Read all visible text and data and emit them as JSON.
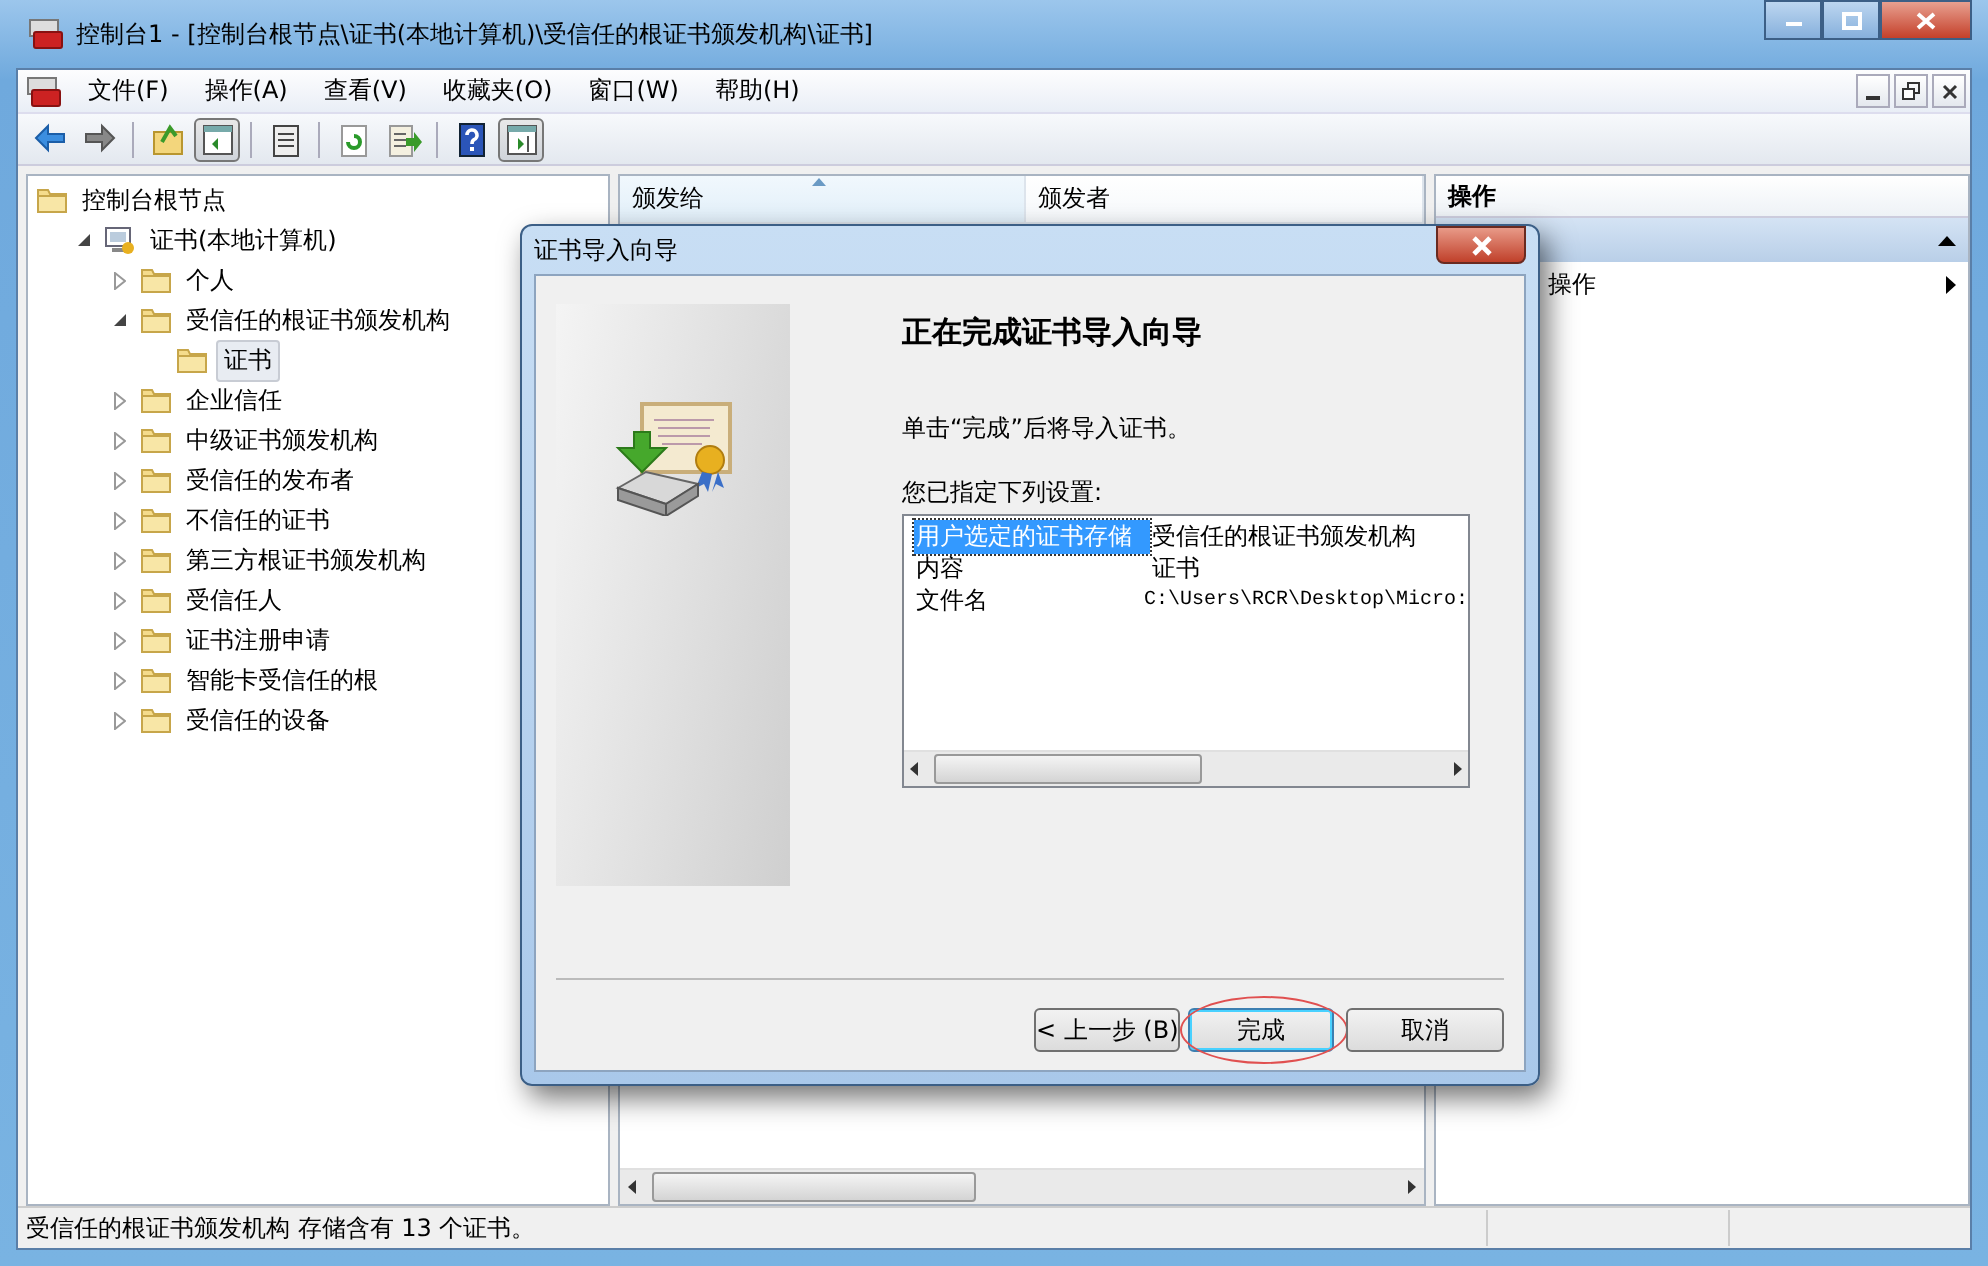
{
  "window": {
    "title": "控制台1 - [控制台根节点\\证书(本地计算机)\\受信任的根证书颁发机构\\证书]"
  },
  "menu": [
    "文件(F)",
    "操作(A)",
    "查看(V)",
    "收藏夹(O)",
    "窗口(W)",
    "帮助(H)"
  ],
  "toolbar": [
    {
      "kind": "back",
      "pressed": false
    },
    {
      "kind": "forward",
      "pressed": false
    },
    {
      "kind": "sep"
    },
    {
      "kind": "up",
      "pressed": false
    },
    {
      "kind": "tree",
      "pressed": true
    },
    {
      "kind": "sep"
    },
    {
      "kind": "clipboard",
      "pressed": false
    },
    {
      "kind": "sep"
    },
    {
      "kind": "refresh",
      "pressed": false
    },
    {
      "kind": "export",
      "pressed": false
    },
    {
      "kind": "sep"
    },
    {
      "kind": "help",
      "pressed": false
    },
    {
      "kind": "pane",
      "pressed": true
    }
  ],
  "tree": [
    {
      "label": "控制台根节点",
      "kind": "folder",
      "selected": false,
      "children": [
        {
          "label": "证书(本地计算机)",
          "kind": "store",
          "expanded": true,
          "selected": false,
          "children": [
            {
              "label": "个人",
              "kind": "folder",
              "expanded": false,
              "selected": false
            },
            {
              "label": "受信任的根证书颁发机构",
              "kind": "folder",
              "expanded": true,
              "selected": false,
              "children": [
                {
                  "label": "证书",
                  "kind": "folder",
                  "selected": true
                }
              ]
            },
            {
              "label": "企业信任",
              "kind": "folder",
              "expanded": false,
              "selected": false
            },
            {
              "label": "中级证书颁发机构",
              "kind": "folder",
              "expanded": false,
              "selected": false
            },
            {
              "label": "受信任的发布者",
              "kind": "folder",
              "expanded": false,
              "selected": false
            },
            {
              "label": "不信任的证书",
              "kind": "folder",
              "expanded": false,
              "selected": false
            },
            {
              "label": "第三方根证书颁发机构",
              "kind": "folder",
              "expanded": false,
              "selected": false
            },
            {
              "label": "受信任人",
              "kind": "folder",
              "expanded": false,
              "selected": false
            },
            {
              "label": "证书注册申请",
              "kind": "folder",
              "expanded": false,
              "selected": false
            },
            {
              "label": "智能卡受信任的根",
              "kind": "folder",
              "expanded": false,
              "selected": false
            },
            {
              "label": "受信任的设备",
              "kind": "folder",
              "expanded": false,
              "selected": false
            }
          ]
        }
      ]
    }
  ],
  "list": {
    "columns": [
      {
        "label": "颁发给",
        "sorted": true
      },
      {
        "label": "颁发者",
        "sorted": false
      }
    ]
  },
  "actions": {
    "title": "操作",
    "items": [
      {
        "selected": true,
        "expanded": true
      },
      {
        "label": "操作",
        "selected": false,
        "expanded": false
      }
    ]
  },
  "dialog": {
    "title": "证书导入向导",
    "heading": "正在完成证书导入向导",
    "text": "单击“完成”后将导入证书。",
    "settings_label": "您已指定下列设置:",
    "settings": [
      {
        "key": "用户选定的证书存储",
        "value": "受信任的根证书颁发机构",
        "selected": true,
        "kind": "text"
      },
      {
        "key": "内容",
        "value": "证书",
        "selected": false,
        "kind": "text"
      },
      {
        "key": "文件名",
        "value": "C:\\Users\\RCR\\Desktop\\Micro:",
        "selected": false,
        "kind": "path"
      }
    ],
    "buttons": [
      {
        "label": "< 上一步 (B)",
        "default": false,
        "highlighted": false
      },
      {
        "label": "完成",
        "default": true,
        "highlighted": true
      },
      {
        "label": "取消",
        "default": false,
        "highlighted": false
      }
    ]
  },
  "status_bar": {
    "text": "受信任的根证书颁发机构 存储含有 13 个证书。"
  }
}
